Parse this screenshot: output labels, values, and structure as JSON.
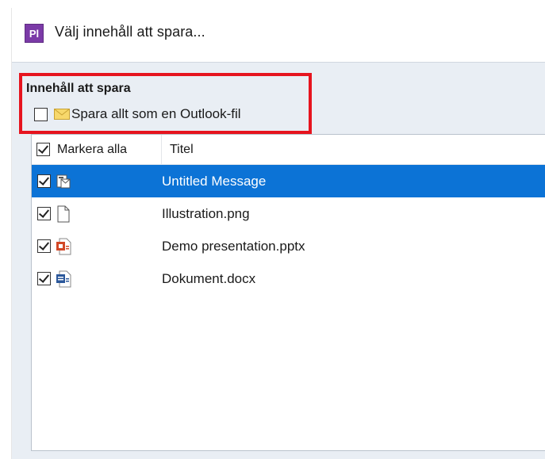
{
  "dialog": {
    "title": "Välj innehåll att spara...",
    "app_icon_text": "Pl",
    "app_icon_color": "#7b3aa7"
  },
  "content": {
    "section_label": "Innehåll att spara",
    "save_as_outlook": {
      "label": "Spara allt som en Outlook-fil",
      "checked": false
    },
    "highlight_color": "#e6141e"
  },
  "list": {
    "columns": {
      "select_all_label": "Markera alla",
      "title_label": "Titel"
    },
    "select_all_checked": true,
    "selected_row_color": "#0c73d6",
    "items": [
      {
        "title": "Untitled Message",
        "checked": true,
        "icon": "email-message-icon",
        "selected": true
      },
      {
        "title": "Illustration.png",
        "checked": true,
        "icon": "blank-file-icon",
        "selected": false
      },
      {
        "title": "Demo presentation.pptx",
        "checked": true,
        "icon": "powerpoint-file-icon",
        "selected": false
      },
      {
        "title": "Dokument.docx",
        "checked": true,
        "icon": "word-file-icon",
        "selected": false
      }
    ]
  }
}
